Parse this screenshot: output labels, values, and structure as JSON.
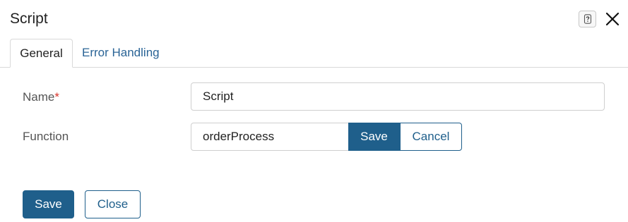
{
  "dialog": {
    "title": "Script",
    "help_icon": "question-mark-icon",
    "close_icon": "close-icon"
  },
  "tabs": [
    {
      "label": "General",
      "active": true
    },
    {
      "label": "Error Handling",
      "active": false
    }
  ],
  "form": {
    "name": {
      "label": "Name",
      "required_mark": "*",
      "value": "Script"
    },
    "function": {
      "label": "Function",
      "value": "orderProcess",
      "save_label": "Save",
      "cancel_label": "Cancel"
    }
  },
  "footer": {
    "save_label": "Save",
    "close_label": "Close"
  },
  "colors": {
    "primary": "#1f5f8b",
    "link": "#2a6496",
    "required": "#d9342b"
  }
}
